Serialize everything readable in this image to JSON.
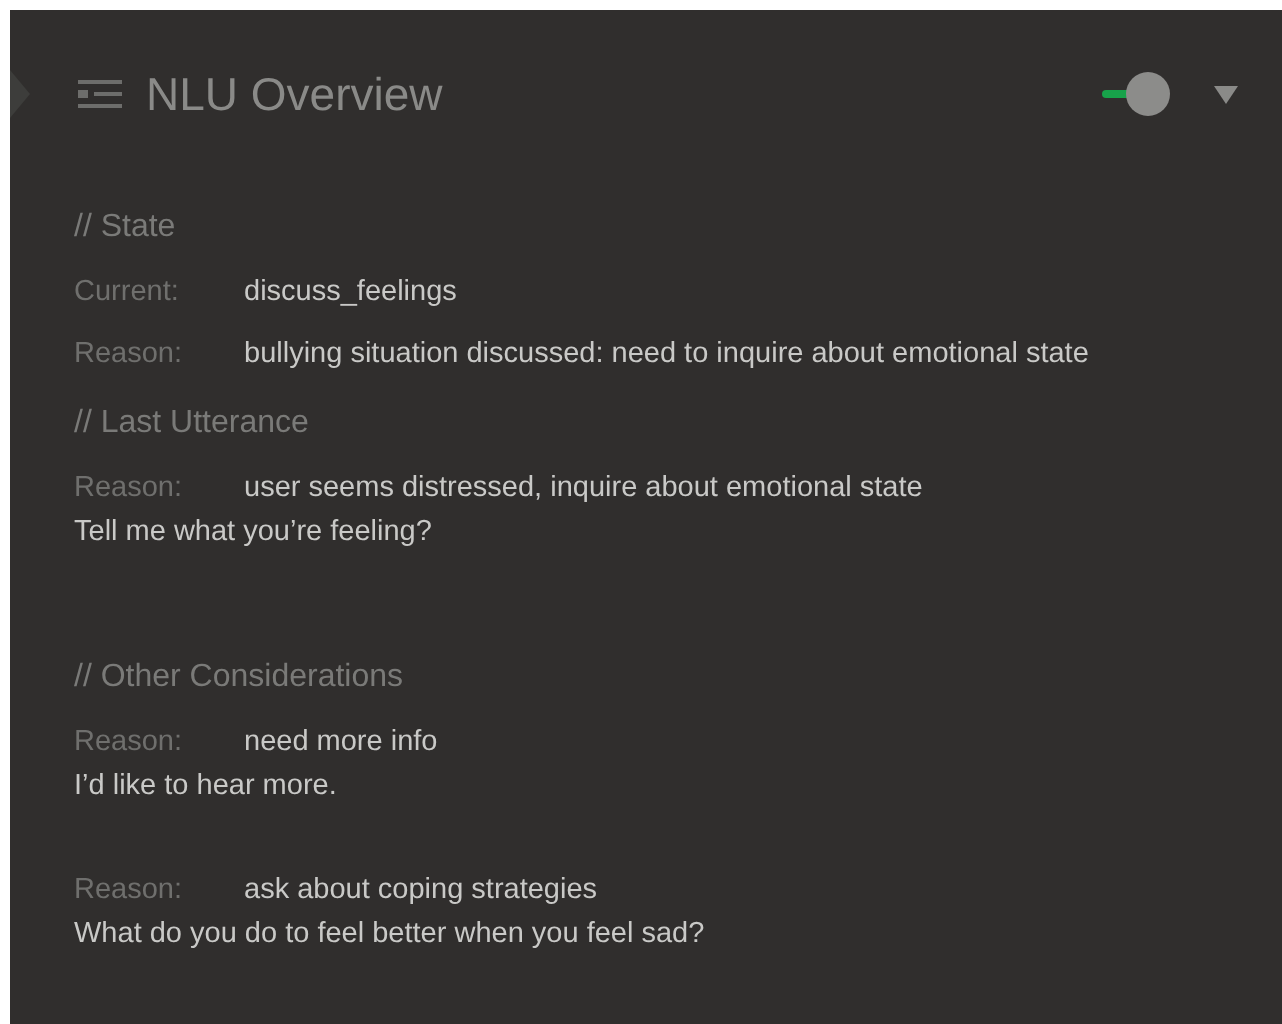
{
  "panel": {
    "title": "NLU Overview",
    "toggle_on": true
  },
  "state": {
    "heading": "// State",
    "rows": [
      {
        "label": "Current:",
        "value": "discuss_feelings"
      },
      {
        "label": "Reason:",
        "value": "bullying situation discussed: need to inquire about emotional state"
      }
    ]
  },
  "last_utterance": {
    "heading": "// Last Utterance",
    "reason_label": "Reason:",
    "reason": "user seems distressed, inquire about emotional state",
    "utterance": "Tell me what you’re feeling?"
  },
  "other_considerations": {
    "heading": "// Other Considerations",
    "items": [
      {
        "reason_label": "Reason:",
        "reason": "need more info",
        "utterance": "I’d like to hear more."
      },
      {
        "reason_label": "Reason:",
        "reason": "ask about coping strategies",
        "utterance": "What do you do to feel better when you feel sad?"
      }
    ]
  }
}
